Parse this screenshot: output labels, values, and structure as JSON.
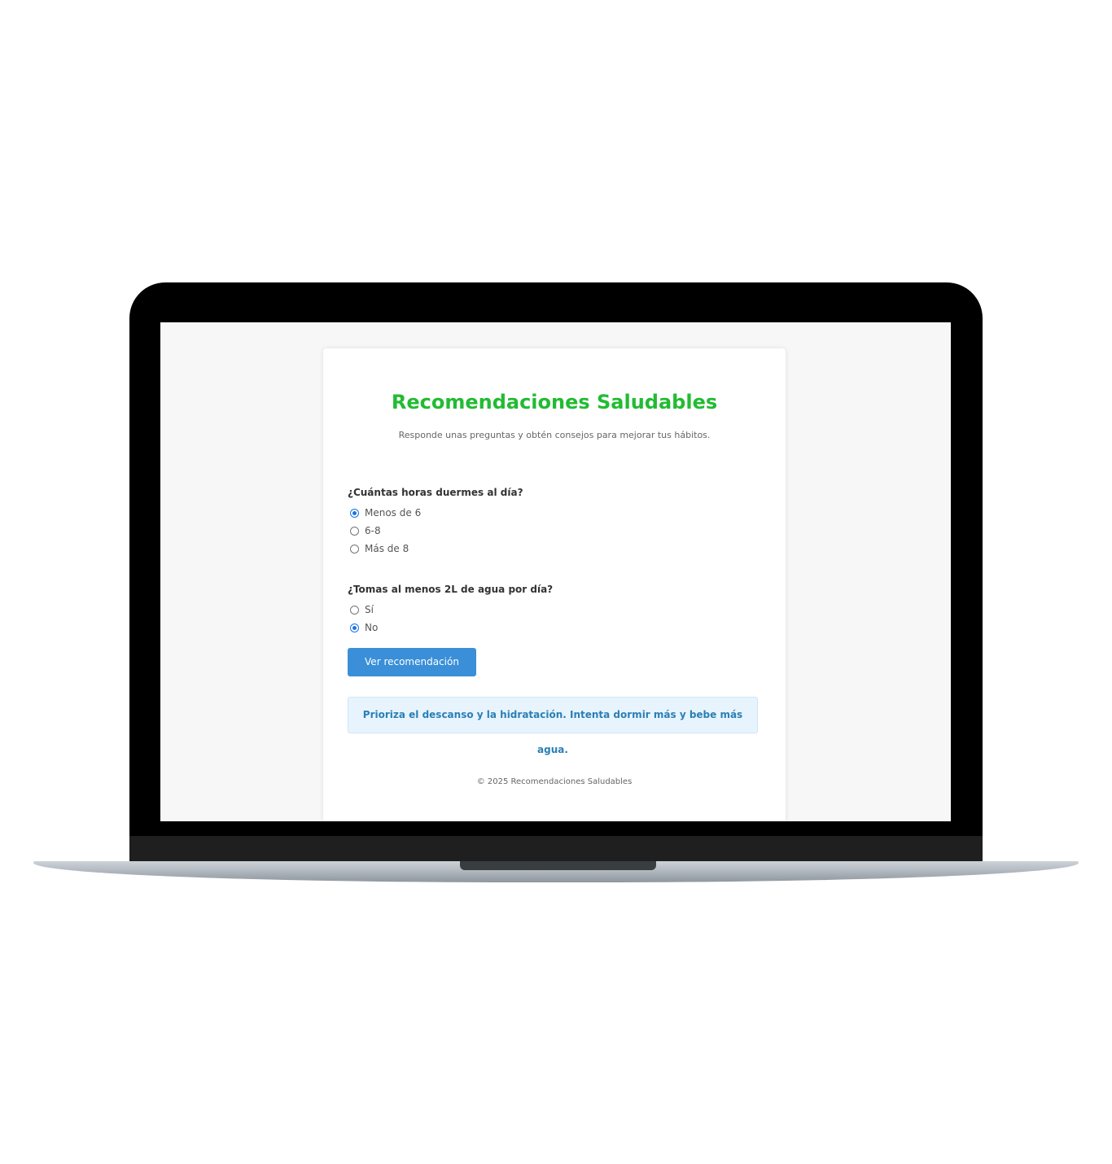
{
  "app": {
    "title": "Recomendaciones Saludables",
    "subtitle": "Responde unas preguntas y obtén consejos para mejorar tus hábitos."
  },
  "questions": [
    {
      "label": "¿Cuántas horas duermes al día?",
      "options": [
        {
          "label": "Menos de 6",
          "checked": true
        },
        {
          "label": "6-8",
          "checked": false
        },
        {
          "label": "Más de 8",
          "checked": false
        }
      ]
    },
    {
      "label": "¿Tomas al menos 2L de agua por día?",
      "options": [
        {
          "label": "Sí",
          "checked": false
        },
        {
          "label": "No",
          "checked": true
        }
      ]
    }
  ],
  "button": {
    "label": "Ver recomendación"
  },
  "result": {
    "text": "Prioriza el descanso y la hidratación. Intenta dormir más y bebe más agua."
  },
  "footer": {
    "text": "© 2025 Recomendaciones Saludables"
  },
  "colors": {
    "title": "#22bb33",
    "button": "#3a8fd8",
    "result_bg": "#e8f4fd",
    "result_text": "#2a7fb5"
  }
}
